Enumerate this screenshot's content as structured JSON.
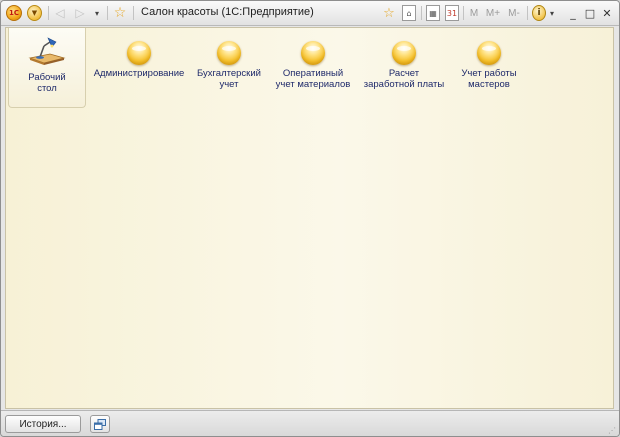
{
  "app": {
    "title": "Салон красоты  (1С:Предприятие)",
    "logo_text": "1С"
  },
  "toolbar": {
    "back_icon": "◁",
    "forward_icon": "▷",
    "dropdown_icon": "▾",
    "favorites_icon": "☆",
    "m_label": "M",
    "m_plus_label": "M+",
    "m_minus_label": "M-",
    "info_label": "i"
  },
  "window_controls": {
    "minimize": "_",
    "maximize": "□",
    "close": "✕"
  },
  "sections": [
    {
      "label": "Рабочий\nстол",
      "icon": "desk-lamp-icon",
      "active": true
    },
    {
      "label": "Администрирование",
      "icon": "yellow-orb-icon",
      "active": false
    },
    {
      "label": "Бухгалтерский\nучет",
      "icon": "yellow-orb-icon",
      "active": false
    },
    {
      "label": "Оперативный\nучет материалов",
      "icon": "yellow-orb-icon",
      "active": false
    },
    {
      "label": "Расчет\nзаработной платы",
      "icon": "yellow-orb-icon",
      "active": false
    },
    {
      "label": "Учет работы\nмастеров",
      "icon": "yellow-orb-icon",
      "active": false
    }
  ],
  "bottom": {
    "history_label": "История..."
  },
  "colors": {
    "content_background": "#f9f5e2",
    "section_label": "#1f2a6a",
    "orb": "#f6c22d"
  }
}
